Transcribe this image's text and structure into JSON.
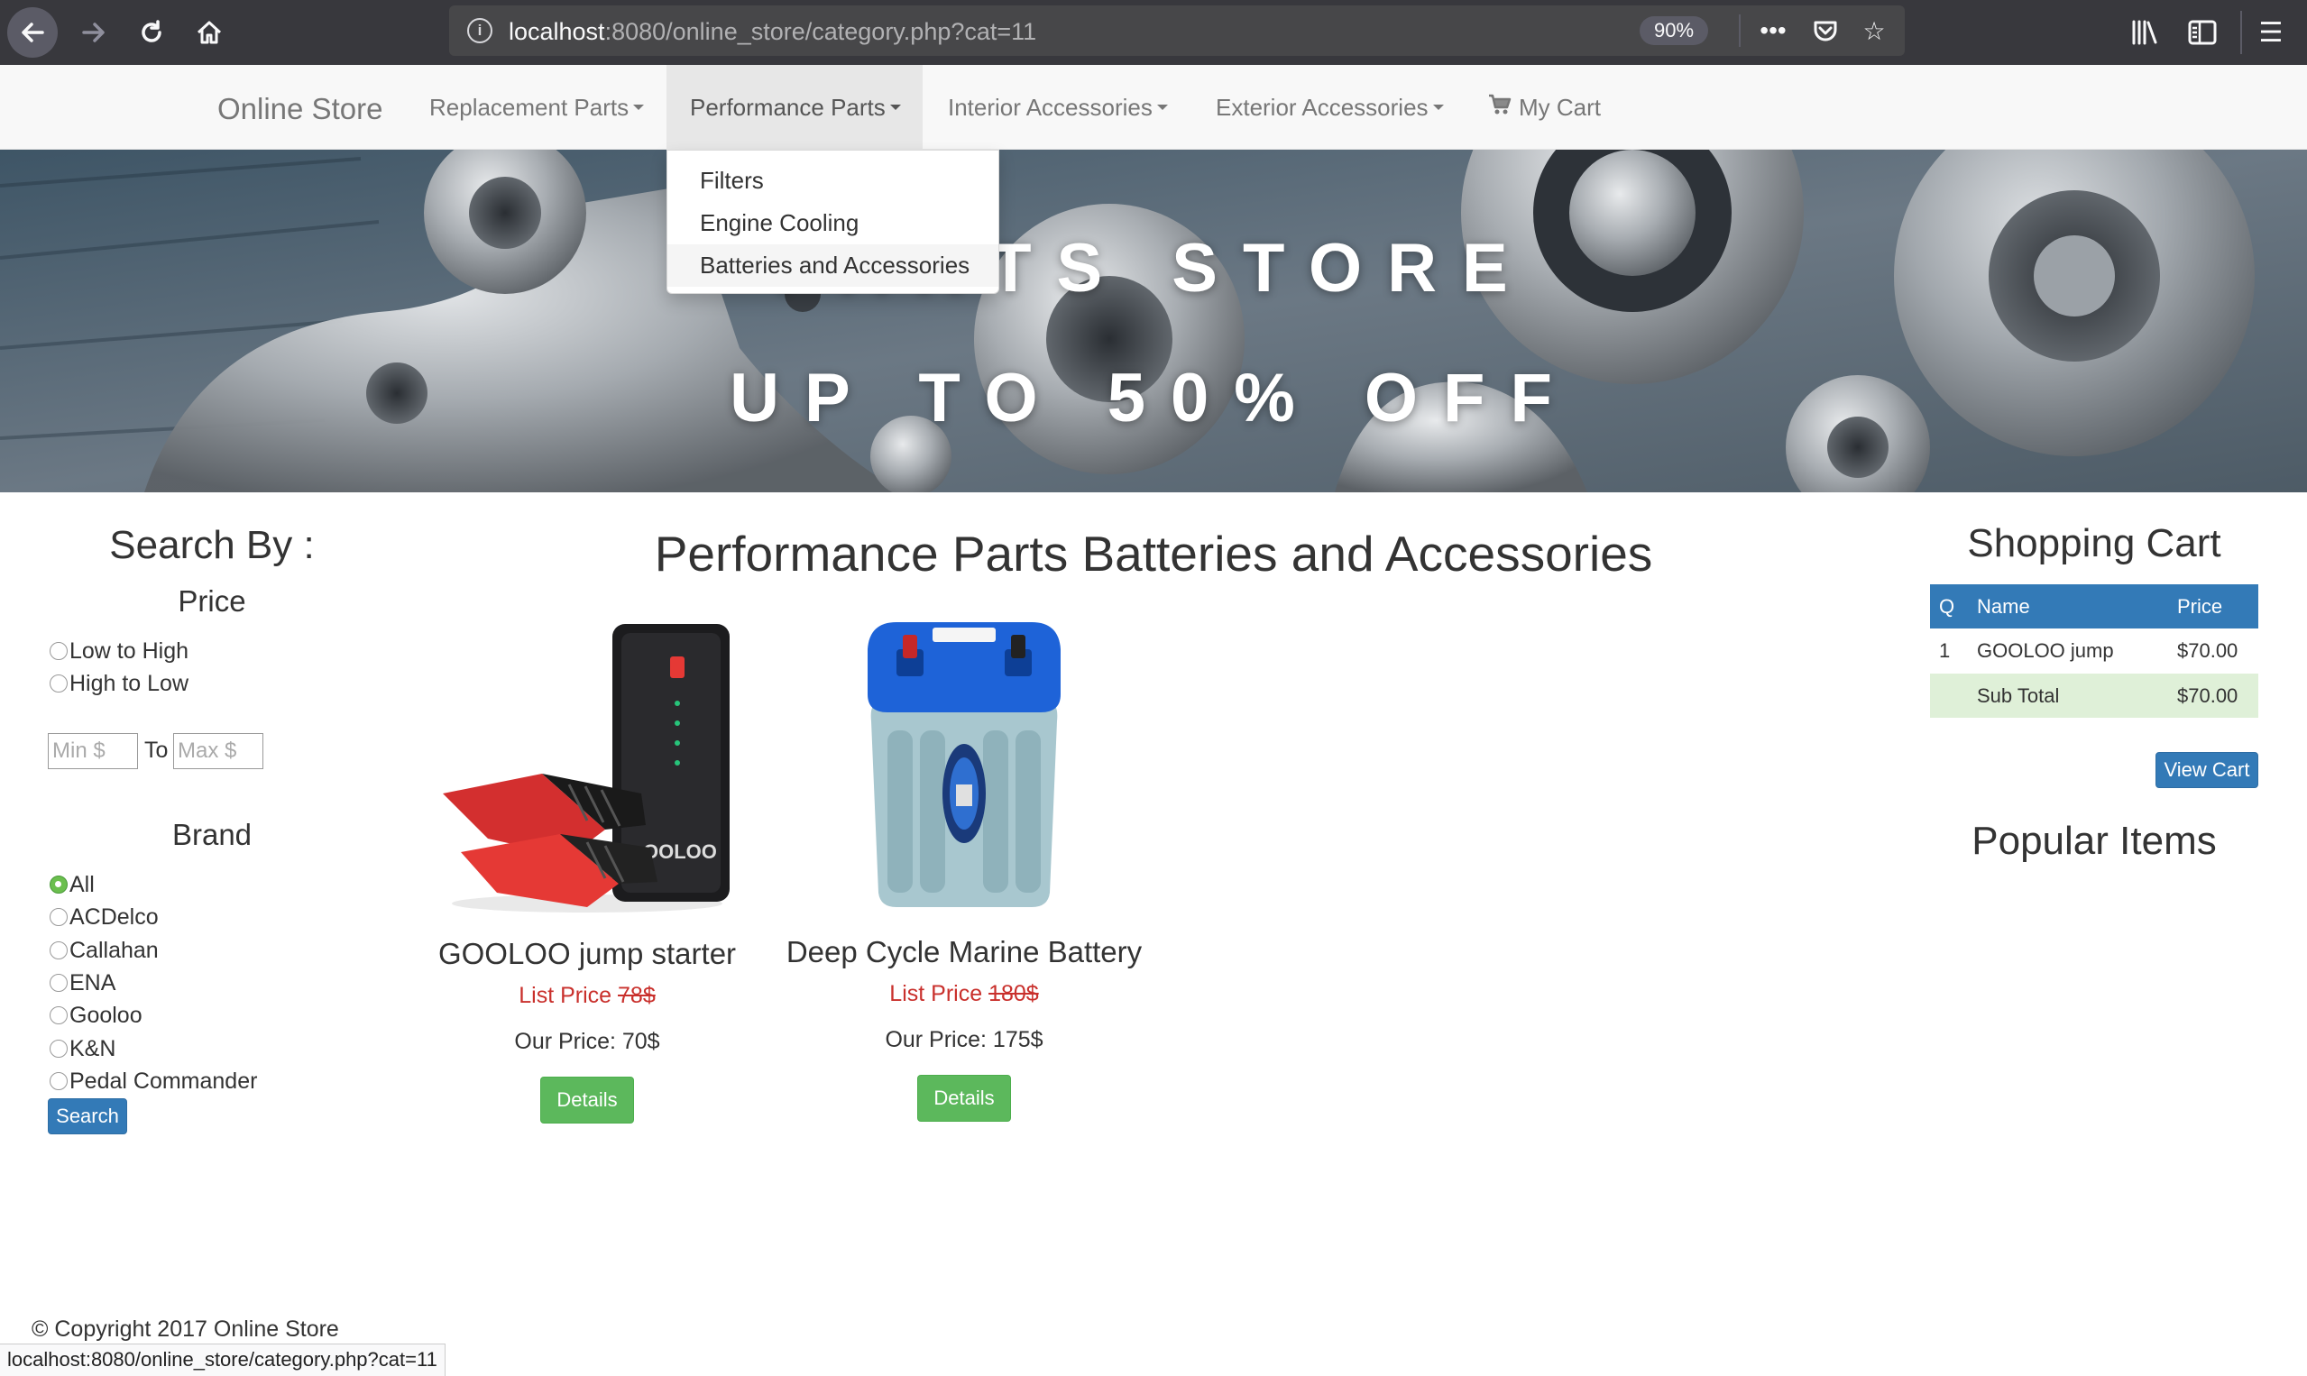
{
  "browser": {
    "url_host": "localhost",
    "url_rest": ":8080/online_store/category.php?cat=11",
    "zoom": "90%",
    "colors": {
      "chrome": "#38383d",
      "url_bar": "#474749"
    }
  },
  "navbar": {
    "brand": "Online Store",
    "items": [
      {
        "label": "Replacement Parts"
      },
      {
        "label": "Performance Parts",
        "active": true
      },
      {
        "label": "Interior Accessories"
      },
      {
        "label": "Exterior Accessories"
      }
    ],
    "cart_label": "My Cart"
  },
  "dropdown": {
    "items": [
      "Filters",
      "Engine Cooling",
      "Batteries and Accessories"
    ]
  },
  "hero": {
    "line1": "PARTS STORE",
    "line2": "UP TO 50% OFF"
  },
  "sidebar": {
    "title": "Search By :",
    "price_heading": "Price",
    "sort_options": [
      "Low to High",
      "High to Low"
    ],
    "min_placeholder": "Min $",
    "max_placeholder": "Max $",
    "to_label": "To",
    "brand_heading": "Brand",
    "brands": [
      "All",
      "ACDelco",
      "Callahan",
      "ENA",
      "Gooloo",
      "K&N",
      "Pedal Commander"
    ],
    "selected_brand": "All",
    "search_button": "Search"
  },
  "main": {
    "title": "Performance Parts Batteries and Accessories",
    "products": [
      {
        "name": "GOOLOO jump starter",
        "list_label": "List Price",
        "list_price": "78$",
        "our_label": "Our Price:",
        "our_price": "70$",
        "button": "Details",
        "image": "jump-starter-image"
      },
      {
        "name": "Deep Cycle Marine Battery",
        "list_label": "List Price",
        "list_price": "180$",
        "our_label": "Our Price:",
        "our_price": "175$",
        "button": "Details",
        "image": "marine-battery-image"
      }
    ]
  },
  "cart": {
    "title": "Shopping Cart",
    "columns": [
      "Q",
      "Name",
      "Price"
    ],
    "rows": [
      {
        "q": "1",
        "name": "GOOLOO jump",
        "price": "$70.00"
      }
    ],
    "subtotal_label": "Sub Total",
    "subtotal_value": "$70.00",
    "view_button": "View Cart",
    "popular_title": "Popular Items"
  },
  "footer": {
    "copyright": "© Copyright 2017 Online Store"
  },
  "status_bar": {
    "url": "localhost:8080/online_store/category.php?cat=11"
  },
  "colors": {
    "primary": "#337ab7",
    "success": "#5cb85c",
    "danger": "#c9302c",
    "subtotal_bg": "#dff0d8"
  }
}
